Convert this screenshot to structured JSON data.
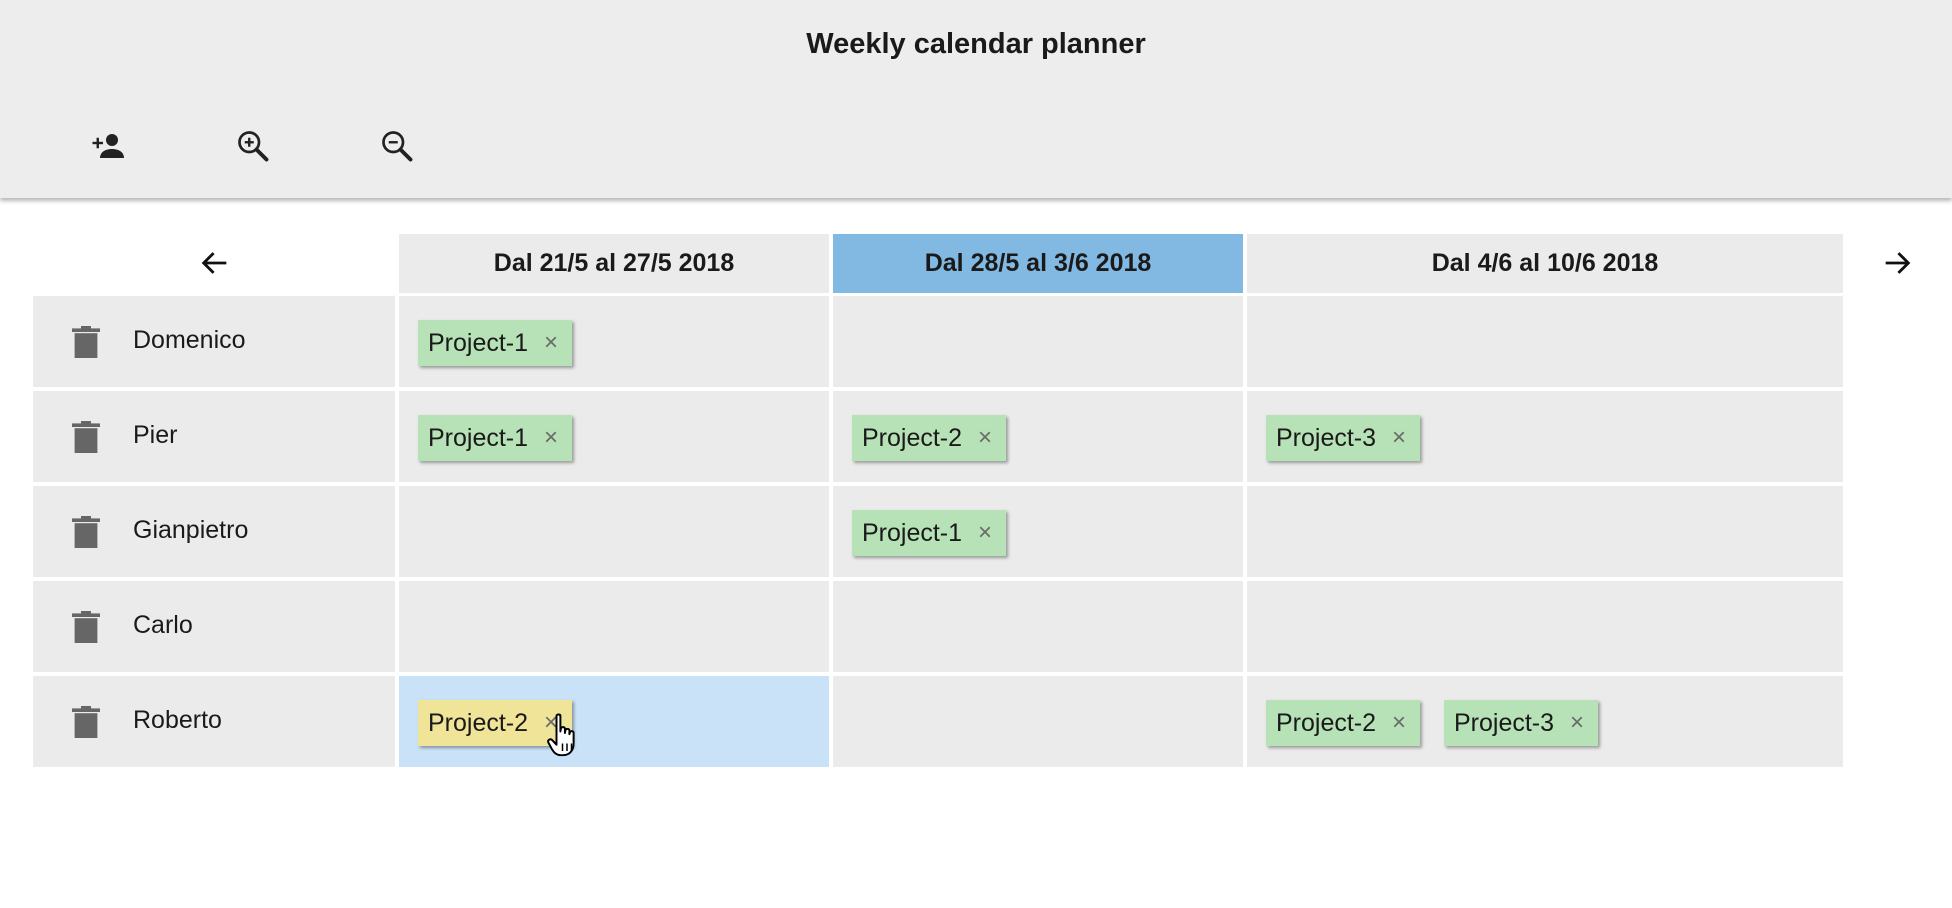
{
  "header": {
    "title": "Weekly calendar planner",
    "tools": [
      {
        "icon": "add-person-icon"
      },
      {
        "icon": "zoom-in-icon"
      },
      {
        "icon": "zoom-out-icon"
      }
    ]
  },
  "navigation": {
    "prev_icon": "arrow-left-icon",
    "next_icon": "arrow-right-icon"
  },
  "weeks": [
    {
      "label": "Dal 21/5 al 27/5 2018",
      "current": false
    },
    {
      "label": "Dal 28/5 al 3/6 2018",
      "current": true
    },
    {
      "label": "Dal 4/6 al 10/6 2018",
      "current": false
    }
  ],
  "rows": [
    {
      "name": "Domenico",
      "cells": [
        [
          "Project-1"
        ],
        [],
        []
      ]
    },
    {
      "name": "Pier",
      "cells": [
        [
          "Project-1"
        ],
        [
          "Project-2"
        ],
        [
          "Project-3"
        ]
      ]
    },
    {
      "name": "Gianpietro",
      "cells": [
        [],
        [
          "Project-1"
        ],
        []
      ]
    },
    {
      "name": "Carlo",
      "cells": [
        [],
        [],
        []
      ]
    },
    {
      "name": "Roberto",
      "cells": [
        [
          "Project-2"
        ],
        [],
        [
          "Project-2",
          "Project-3"
        ]
      ]
    }
  ],
  "chip_remove_symbol": "×",
  "colors": {
    "header_bg": "#ededed",
    "cell_bg": "#ebebeb",
    "current_week": "#82b9e3",
    "selected_cell": "#c9e2f8",
    "chip": "#b7e1b6",
    "chip_active": "#efe497"
  }
}
